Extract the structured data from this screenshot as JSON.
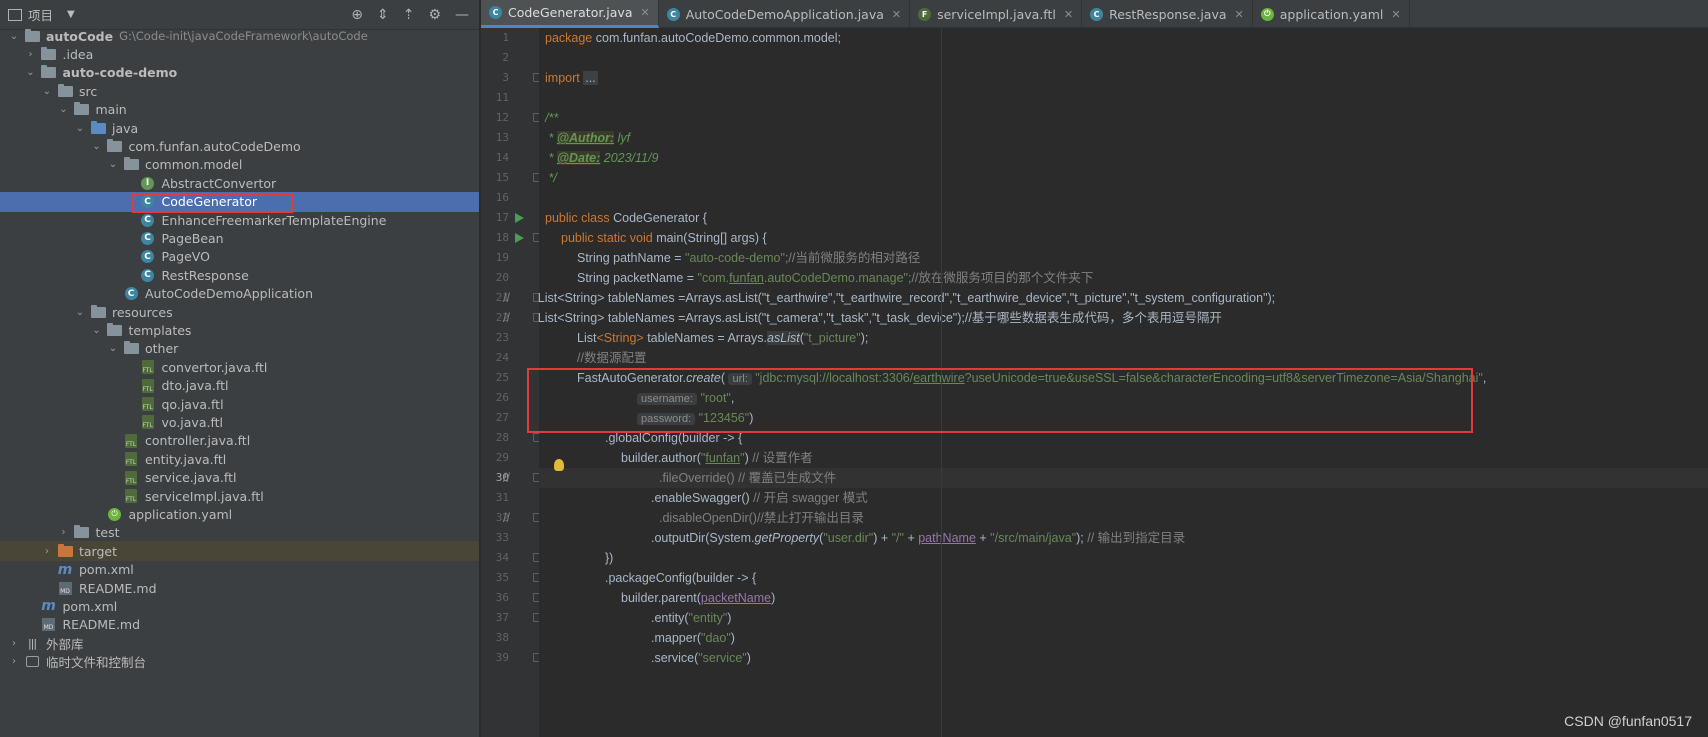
{
  "project_panel": {
    "title": "项目",
    "tree": [
      {
        "label": "autoCode",
        "path": "G:\\Code-init\\javaCodeFramework\\autoCode",
        "depth": 0,
        "open": true,
        "icon": "module-folder-icon",
        "bold": true
      },
      {
        "label": ".idea",
        "depth": 1,
        "open": false,
        "icon": "folder-icon"
      },
      {
        "label": "auto-code-demo",
        "depth": 1,
        "open": true,
        "icon": "module-folder-icon",
        "bold": true
      },
      {
        "label": "src",
        "depth": 2,
        "open": true,
        "icon": "folder-icon"
      },
      {
        "label": "main",
        "depth": 3,
        "open": true,
        "icon": "folder-icon"
      },
      {
        "label": "java",
        "depth": 4,
        "open": true,
        "icon": "source-folder-icon"
      },
      {
        "label": "com.funfan.autoCodeDemo",
        "depth": 5,
        "open": true,
        "icon": "package-icon"
      },
      {
        "label": "common.model",
        "depth": 6,
        "open": true,
        "icon": "package-icon"
      },
      {
        "label": "AbstractConvertor",
        "depth": 7,
        "icon": "interface-icon"
      },
      {
        "label": "CodeGenerator",
        "depth": 7,
        "icon": "class-icon",
        "selected": true
      },
      {
        "label": "EnhanceFreemarkerTemplateEngine",
        "depth": 7,
        "icon": "class-icon"
      },
      {
        "label": "PageBean",
        "depth": 7,
        "icon": "class-icon"
      },
      {
        "label": "PageVO",
        "depth": 7,
        "icon": "class-icon"
      },
      {
        "label": "RestResponse",
        "depth": 7,
        "icon": "class-icon"
      },
      {
        "label": "AutoCodeDemoApplication",
        "depth": 6,
        "icon": "spring-class-icon"
      },
      {
        "label": "resources",
        "depth": 4,
        "open": true,
        "icon": "resources-folder-icon"
      },
      {
        "label": "templates",
        "depth": 5,
        "open": true,
        "icon": "folder-icon"
      },
      {
        "label": "other",
        "depth": 6,
        "open": true,
        "icon": "folder-icon"
      },
      {
        "label": "convertor.java.ftl",
        "depth": 7,
        "icon": "ftl-file-icon"
      },
      {
        "label": "dto.java.ftl",
        "depth": 7,
        "icon": "ftl-file-icon"
      },
      {
        "label": "qo.java.ftl",
        "depth": 7,
        "icon": "ftl-file-icon"
      },
      {
        "label": "vo.java.ftl",
        "depth": 7,
        "icon": "ftl-file-icon"
      },
      {
        "label": "controller.java.ftl",
        "depth": 6,
        "icon": "ftl-file-icon"
      },
      {
        "label": "entity.java.ftl",
        "depth": 6,
        "icon": "ftl-file-icon"
      },
      {
        "label": "service.java.ftl",
        "depth": 6,
        "icon": "ftl-file-icon"
      },
      {
        "label": "serviceImpl.java.ftl",
        "depth": 6,
        "icon": "ftl-file-icon"
      },
      {
        "label": "application.yaml",
        "depth": 5,
        "icon": "yaml-file-icon"
      },
      {
        "label": "test",
        "depth": 3,
        "open": false,
        "icon": "folder-icon"
      },
      {
        "label": "target",
        "depth": 2,
        "open": false,
        "icon": "excluded-folder-icon",
        "excluded": true
      },
      {
        "label": "pom.xml",
        "depth": 2,
        "icon": "maven-file-icon"
      },
      {
        "label": "README.md",
        "depth": 2,
        "icon": "markdown-file-icon"
      },
      {
        "label": "pom.xml",
        "depth": 1,
        "icon": "maven-file-icon"
      },
      {
        "label": "README.md",
        "depth": 1,
        "icon": "markdown-file-icon"
      },
      {
        "label": "外部库",
        "depth": 0,
        "open": false,
        "icon": "libraries-icon"
      },
      {
        "label": "临时文件和控制台",
        "depth": 0,
        "open": false,
        "icon": "scratches-icon"
      }
    ]
  },
  "tabs": [
    {
      "label": "CodeGenerator.java",
      "active": true,
      "icon": "class-icon",
      "color": "#3e86a0",
      "glyph": "C"
    },
    {
      "label": "AutoCodeDemoApplication.java",
      "active": false,
      "icon": "class-icon",
      "color": "#3e86a0",
      "glyph": "C"
    },
    {
      "label": "serviceImpl.java.ftl",
      "active": false,
      "icon": "ftl-file-icon",
      "color": "#4f6b3c",
      "glyph": "F"
    },
    {
      "label": "RestResponse.java",
      "active": false,
      "icon": "class-icon",
      "color": "#3e86a0",
      "glyph": "C"
    },
    {
      "label": "application.yaml",
      "active": false,
      "icon": "yaml-file-icon",
      "color": "#6db33f",
      "glyph": "⏻"
    }
  ],
  "editor": {
    "line_numbers": [
      "1",
      "2",
      "3",
      "11",
      "12",
      "13",
      "14",
      "15",
      "16",
      "17",
      "18",
      "19",
      "20",
      "21",
      "22",
      "23",
      "24",
      "25",
      "26",
      "27",
      "28",
      "29",
      "30",
      "31",
      "32",
      "33",
      "34",
      "35",
      "36",
      "37",
      "38",
      "39"
    ],
    "current_line": "30",
    "code": {
      "l1_kw": "package",
      "l1_rest": " com.funfan.autoCodeDemo.common.model;",
      "l3_kw": "import",
      "l3_dots": "...",
      "l12": "/**",
      "l13_star": " * ",
      "l13_tag": "@Author:",
      "l13_val": " lyf",
      "l14_star": " * ",
      "l14_tag": "@Date:",
      "l14_val": " 2023/11/9",
      "l15": " */",
      "l17_kw": "public class",
      "l17_rest": " CodeGenerator {",
      "l18_kw": "public static void",
      "l18_rest": " main(String[] args) {",
      "l19_a": "String pathName = ",
      "l19_s": "\"auto-code-demo\"",
      "l19_c": ";//当前微服务的相对路径",
      "l20_a": "String packetName = ",
      "l20_s1": "\"com.",
      "l20_s2": "funfan",
      "l20_s3": ".autoCodeDemo.manage\"",
      "l20_c": ";//放在微服务项目的那个文件夹下",
      "l21_prefix": "//",
      "l21": "        List<String> tableNames =Arrays.asList(\"t_earthwire\",\"t_earthwire_record\",\"t_earthwire_device\",\"t_picture\",\"t_system_configuration\");",
      "l22_prefix": "//",
      "l22": "        List<String> tableNames =Arrays.asList(\"t_camera\",\"t_task\",\"t_task_device\");//基于哪些数据表生成代码，多个表用逗号隔开",
      "l23_a": "List",
      "l23_b": "<String>",
      "l23_c": " tableNames = Arrays.",
      "l23_d": "asList",
      "l23_e": "(",
      "l23_s": "\"t_picture\"",
      "l23_f": ");",
      "l24": "//数据源配置",
      "l25_a": "FastAutoGenerator.",
      "l25_b": "create",
      "l25_c": "( ",
      "l25_hint": "url:",
      "l25_s1": " \"jdbc:mysql://localhost:3306/",
      "l25_s2": "earthwire",
      "l25_s3": "?useUnicode=true&useSSL=false&characterEncoding=utf8&serverTimezone=Asia/Shanghai\"",
      "l25_d": ",",
      "l26_hint": "username:",
      "l26_s": " \"root\"",
      "l26_d": ",",
      "l27_hint": "password:",
      "l27_s": " \"123456\"",
      "l27_d": ")",
      "l28": ".globalConfig(builder -> {",
      "l29_a": "builder.author(",
      "l29_s1": "\"",
      "l29_s2": "funfan",
      "l29_s3": "\"",
      "l29_c": ") ",
      "l29_cm": "// 设置作者",
      "l30_prefix": "//",
      "l30": ".fileOverride() // 覆盖已生成文件",
      "l31_a": ".enableSwagger() ",
      "l31_cm": "// 开启 swagger 模式",
      "l32_prefix": "//",
      "l32": ".disableOpenDir()//禁止打开输出目录",
      "l33_a": ".outputDir(System.",
      "l33_b": "getProperty",
      "l33_c": "(",
      "l33_s1": "\"user.dir\"",
      "l33_d": ") + ",
      "l33_s2": "\"/\"",
      "l33_e": " + ",
      "l33_f": "pathName",
      "l33_g": " + ",
      "l33_s3": "\"/src/main/java\"",
      "l33_h": "); ",
      "l33_cm": "// 输出到指定目录",
      "l34": "})",
      "l35": ".packageConfig(builder -> {",
      "l36_a": "builder.parent(",
      "l36_f": "packetName",
      "l36_b": ")",
      "l37_a": ".entity(",
      "l37_s": "\"entity\"",
      "l37_b": ")",
      "l38_a": ".mapper(",
      "l38_s": "\"dao\"",
      "l38_b": ")",
      "l39_a": ".service(",
      "l39_s": "\"service\"",
      "l39_b": ")"
    }
  },
  "watermark": "CSDN @funfan0517",
  "colors": {
    "keyword": "#cc7832",
    "string": "#6a8759",
    "comment": "#808080",
    "doc": "#629755",
    "field": "#9876aa",
    "highlight_box": "#e33b3b",
    "selection": "#4b6eaf"
  }
}
